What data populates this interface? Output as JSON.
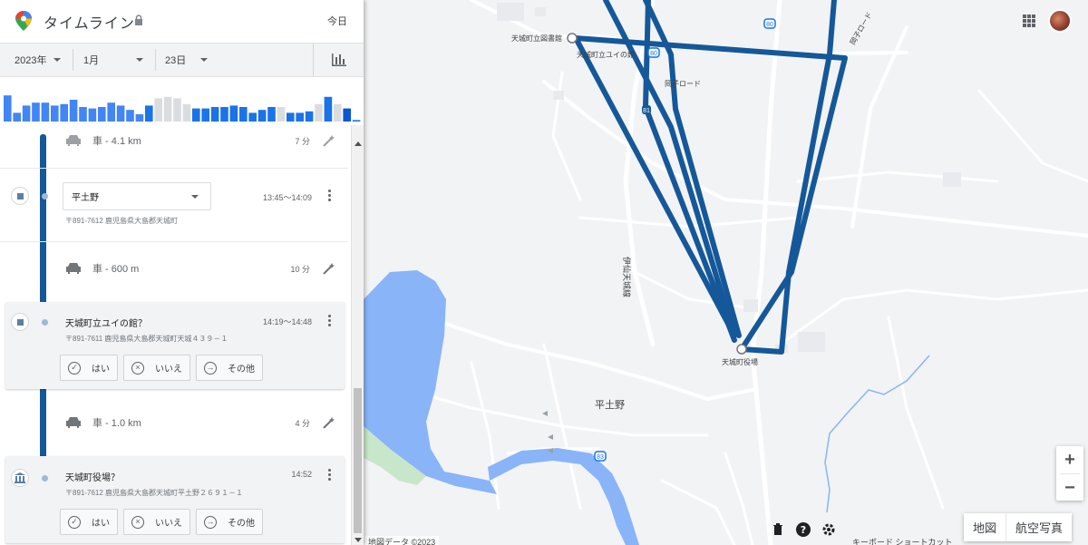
{
  "header": {
    "title": "タイムライン",
    "today": "今日"
  },
  "date_filter": {
    "year": "2023年",
    "month": "1月",
    "day": "23日"
  },
  "histogram": {
    "bars": [
      {
        "v": 0.9,
        "c": "#4285f4"
      },
      {
        "v": 0.3,
        "c": "#4285f4"
      },
      {
        "v": 0.55,
        "c": "#4285f4"
      },
      {
        "v": 0.65,
        "c": "#4285f4"
      },
      {
        "v": 0.65,
        "c": "#4285f4"
      },
      {
        "v": 0.55,
        "c": "#4285f4"
      },
      {
        "v": 0.6,
        "c": "#4285f4"
      },
      {
        "v": 0.75,
        "c": "#4285f4"
      },
      {
        "v": 0.5,
        "c": "#4285f4"
      },
      {
        "v": 0.45,
        "c": "#4285f4"
      },
      {
        "v": 0.5,
        "c": "#4285f4"
      },
      {
        "v": 0.65,
        "c": "#4285f4"
      },
      {
        "v": 0.55,
        "c": "#4285f4"
      },
      {
        "v": 0.4,
        "c": "#4285f4"
      },
      {
        "v": 0.25,
        "c": "#4285f4"
      },
      {
        "v": 0.55,
        "c": "#1a73e8"
      },
      {
        "v": 0.8,
        "c": "#dadce0"
      },
      {
        "v": 0.85,
        "c": "#dadce0"
      },
      {
        "v": 0.8,
        "c": "#dadce0"
      },
      {
        "v": 0.6,
        "c": "#dadce0"
      },
      {
        "v": 0.45,
        "c": "#1a73e8"
      },
      {
        "v": 0.45,
        "c": "#1a73e8"
      },
      {
        "v": 0.5,
        "c": "#1a73e8"
      },
      {
        "v": 0.5,
        "c": "#1a73e8"
      },
      {
        "v": 0.55,
        "c": "#1a73e8"
      },
      {
        "v": 0.5,
        "c": "#1a73e8"
      },
      {
        "v": 0.3,
        "c": "#1a73e8"
      },
      {
        "v": 0.4,
        "c": "#1a73e8"
      },
      {
        "v": 0.5,
        "c": "#1a73e8"
      },
      {
        "v": 0.5,
        "c": "#dadce0"
      },
      {
        "v": 0.3,
        "c": "#1a73e8"
      },
      {
        "v": 0.3,
        "c": "#1a73e8"
      },
      {
        "v": 0.35,
        "c": "#1a73e8"
      },
      {
        "v": 0.6,
        "c": "#dadce0"
      },
      {
        "v": 0.85,
        "c": "#1a73e8"
      },
      {
        "v": 0.6,
        "c": "#dadce0"
      },
      {
        "v": 0.45,
        "c": "#0b57d0"
      },
      {
        "v": 0.05,
        "c": "#1a73e8"
      }
    ]
  },
  "timeline": {
    "moves": [
      {
        "mode": "車 - 4.1 km",
        "duration": "7 分"
      },
      {
        "mode": "車 - 600 m",
        "duration": "10 分"
      },
      {
        "mode": "車 - 1.0 km",
        "duration": "4 分"
      }
    ],
    "places": [
      {
        "name": "平土野",
        "time": "13:45～14:09",
        "address": "〒891-7612 鹿児島県大島郡天城町"
      },
      {
        "name": "天城町立ユイの館？",
        "time": "14:19～14:48",
        "address": "〒891-7611 鹿児島県大島郡天城町天城４３９－１"
      },
      {
        "name": "天城町役場？",
        "time": "14:52",
        "address": "〒891-7612 鹿児島県大島郡天城町平土野２６９１－１"
      }
    ],
    "confirm": {
      "yes": "はい",
      "no": "いいえ",
      "other": "その他"
    }
  },
  "map": {
    "labels": {
      "library": "天城町立図書館",
      "yui": "天城町立ユイの館",
      "road1": "岡子ロード",
      "road2": "岡子ロード",
      "route": "伊仙天城線",
      "office": "天城町役場",
      "hetono": "平土野",
      "shield80a": "80",
      "shield80b": "80",
      "shield83": "83",
      "shield81": "81"
    },
    "zoom_in": "+",
    "zoom_out": "−",
    "map_button": "地図",
    "satellite_button": "航空写真",
    "attribution": "地図データ ©2023",
    "shortcuts": "キーボード ショートカット"
  },
  "colors": {
    "route": "#15589a",
    "water": "#8ab4f8",
    "park": "#c8e6c9"
  }
}
